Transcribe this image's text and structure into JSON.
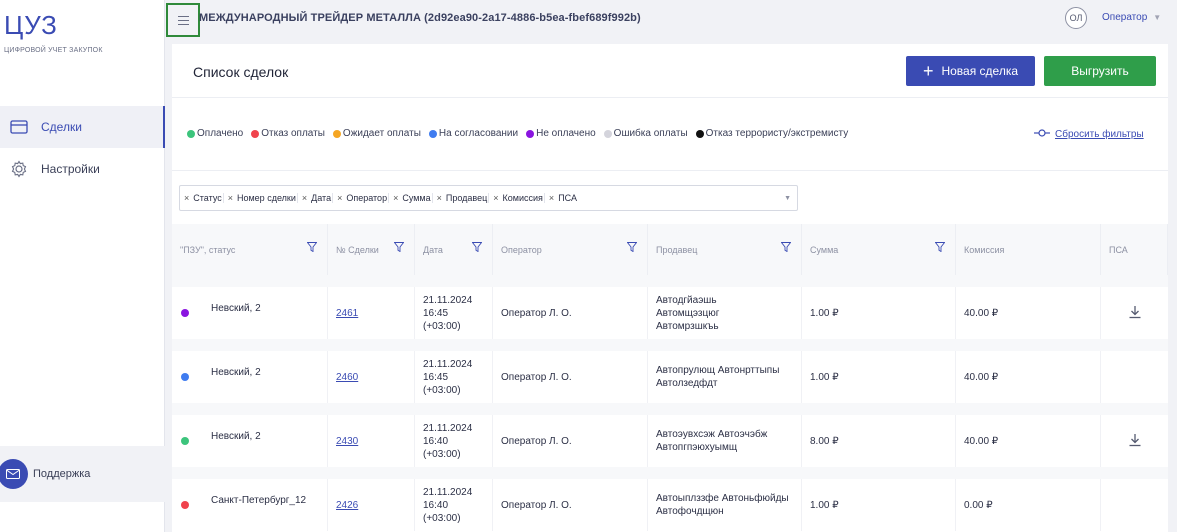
{
  "sidebar": {
    "logo_title": "ЦУЗ",
    "logo_subtitle": "цифровой учет закупок",
    "items": [
      {
        "label": "Сделки",
        "icon": "card-icon",
        "active": true
      },
      {
        "label": "Настройки",
        "icon": "gear-icon",
        "active": false
      }
    ],
    "support_label": "Поддержка"
  },
  "topbar": {
    "company": "МЕЖДУНАРОДНЫЙ ТРЕЙДЕР МЕТАЛЛА (2d92ea90-2a17-4886-b5ea-fbef689f992b)",
    "avatar_initials": "ОЛ",
    "role": "Оператор"
  },
  "main": {
    "title": "Список сделок",
    "new_deal_label": "Новая сделка",
    "export_label": "Выгрузить",
    "reset_filters_label": "Сбросить фильтры"
  },
  "legend": [
    {
      "label": "Оплачено",
      "color": "#3cc47c"
    },
    {
      "label": "Отказ оплаты",
      "color": "#f0434d"
    },
    {
      "label": "Ожидает оплаты",
      "color": "#f5a623"
    },
    {
      "label": "На согласовании",
      "color": "#3f7cf0"
    },
    {
      "label": "Не оплачено",
      "color": "#8a14e0"
    },
    {
      "label": "Ошибка оплаты",
      "color": "#d4d4dc"
    },
    {
      "label": "Отказ террористу/экстремисту",
      "color": "#111111"
    }
  ],
  "column_chips": [
    "Статус",
    "Номер сделки",
    "Дата",
    "Оператор",
    "Сумма",
    "Продавец",
    "Комиссия",
    "ПСА"
  ],
  "table": {
    "headers": [
      "\"ПЗУ\", статус",
      "№ Сделки",
      "Дата",
      "Оператор",
      "Продавец",
      "Сумма",
      "Комиссия",
      "ПСА"
    ],
    "rows": [
      {
        "status_color": "#8a14e0",
        "pzu": "Невский, 2",
        "deal": "2461",
        "date": "21.11.2024",
        "time": "16:45",
        "tz": "(+03:00)",
        "operator": "Оператор Л. О.",
        "seller": [
          "Автодгйаэшь",
          "Автомщэзцюг",
          "Автомрзшкъь"
        ],
        "sum": "1.00 ₽",
        "commission": "40.00 ₽",
        "psa": true
      },
      {
        "status_color": "#3f7cf0",
        "pzu": "Невский, 2",
        "deal": "2460",
        "date": "21.11.2024",
        "time": "16:45",
        "tz": "(+03:00)",
        "operator": "Оператор Л. О.",
        "seller": [
          "Автопрулющ Автонрттыпы",
          "Автолзедфдт"
        ],
        "sum": "1.00 ₽",
        "commission": "40.00 ₽",
        "psa": false
      },
      {
        "status_color": "#3cc47c",
        "pzu": "Невский, 2",
        "deal": "2430",
        "date": "21.11.2024",
        "time": "16:40",
        "tz": "(+03:00)",
        "operator": "Оператор Л. О.",
        "seller": [
          "Автоэувхсэж Автоэчэбж",
          "Автопгпэюхуымщ"
        ],
        "sum": "8.00 ₽",
        "commission": "40.00 ₽",
        "psa": true
      },
      {
        "status_color": "#f0434d",
        "pzu": "Санкт-Петербург_12",
        "deal": "2426",
        "date": "21.11.2024",
        "time": "16:40",
        "tz": "(+03:00)",
        "operator": "Оператор Л. О.",
        "seller": [
          "Автоыплззфе Автоньфюйды",
          "Автофочдщюн"
        ],
        "sum": "1.00 ₽",
        "commission": "0.00 ₽",
        "psa": false
      }
    ]
  }
}
